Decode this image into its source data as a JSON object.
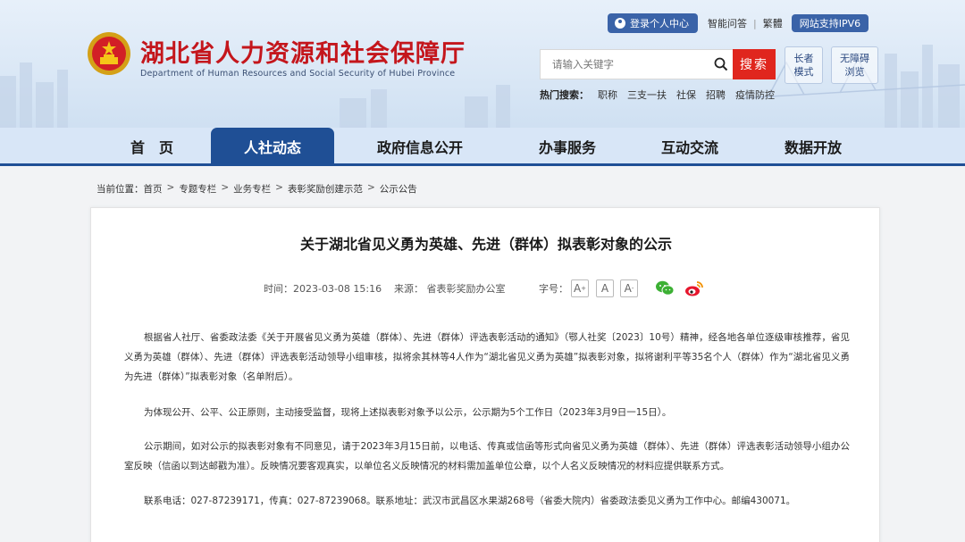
{
  "header": {
    "site_title": "湖北省人力资源和社会保障厅",
    "site_subtitle": "Department of Human Resources and Social Security of Hubei Province",
    "login_label": "登录个人中心",
    "qa_label": "智能问答",
    "traditional_label": "繁體",
    "ipv6_label": "网站支持IPV6",
    "search": {
      "placeholder": "请输入关键字",
      "button_label": "搜索"
    },
    "hot_label": "热门搜索：",
    "hot_items": [
      "职称",
      "三支一扶",
      "社保",
      "招聘",
      "疫情防控"
    ],
    "elder_mode": [
      "长者",
      "模式"
    ],
    "barrier_free": [
      "无障碍",
      "浏览"
    ]
  },
  "nav": {
    "items": [
      "首　页",
      "人社动态",
      "政府信息公开",
      "办事服务",
      "互动交流",
      "数据开放"
    ],
    "active_index": 1
  },
  "breadcrumb": {
    "label": "当前位置：",
    "items": [
      "首页",
      "专题专栏",
      "业务专栏",
      "表彰奖励创建示范",
      "公示公告"
    ]
  },
  "article": {
    "title": "关于湖北省见义勇为英雄、先进（群体）拟表彰对象的公示",
    "time": "时间：2023-03-08 15:16",
    "source": "来源：  省表彰奖励办公室",
    "font_label": "字号：",
    "paragraphs": [
      "根据省人社厅、省委政法委《关于开展省见义勇为英雄（群体）、先进（群体）评选表彰活动的通知》（鄂人社奖〔2023〕10号）精神，经各地各单位逐级审核推荐，省见义勇为英雄（群体）、先进（群体）评选表彰活动领导小组审核，拟将余其林等4人作为“湖北省见义勇为英雄”拟表彰对象，拟将谢利平等35名个人（群体）作为“湖北省见义勇为先进（群体）”拟表彰对象（名单附后）。",
      "为体现公开、公平、公正原则，主动接受监督，现将上述拟表彰对象予以公示，公示期为5个工作日（2023年3月9日一15日）。",
      "公示期间，如对公示的拟表彰对象有不同意见，请于2023年3月15日前，以电话、传真或信函等形式向省见义勇为英雄（群体）、先进（群体）评选表彰活动领导小组办公室反映（信函以到达邮戳为准）。反映情况要客观真实，以单位名义反映情况的材料需加盖单位公章，以个人名义反映情况的材料应提供联系方式。",
      "联系电话：027-87239171，传真：027-87239068。联系地址：武汉市武昌区水果湖268号（省委大院内）省委政法委见义勇为工作中心。邮编430071。"
    ]
  },
  "colors": {
    "brand_red": "#c4161c",
    "nav_blue": "#1f4f95",
    "search_red": "#e0261e"
  },
  "icons": [
    "national-emblem-icon",
    "user-icon",
    "search-icon",
    "wechat-icon",
    "weibo-icon"
  ]
}
